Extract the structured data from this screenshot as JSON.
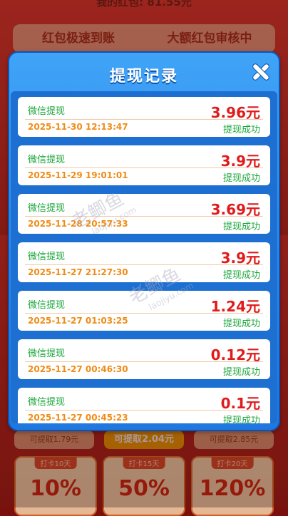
{
  "background": {
    "header": "我的红包: 81.55元",
    "tabs": [
      "红包极速到账",
      "大额红包审核中"
    ],
    "chips": [
      "可提取1.79元",
      "可提取2.04元",
      "可提取2.85元"
    ],
    "cards": [
      {
        "tag": "打卡10天",
        "pct": "10%"
      },
      {
        "tag": "打卡15天",
        "pct": "50%"
      },
      {
        "tag": "打卡20天",
        "pct": "120%"
      }
    ]
  },
  "modal": {
    "title": "提现记录",
    "records": [
      {
        "title": "微信提现",
        "amount": "3.96元",
        "time": "2025-11-30 12:13:47",
        "status": "提现成功"
      },
      {
        "title": "微信提现",
        "amount": "3.9元",
        "time": "2025-11-29 19:01:01",
        "status": "提现成功"
      },
      {
        "title": "微信提现",
        "amount": "3.69元",
        "time": "2025-11-28 20:57:33",
        "status": "提现成功"
      },
      {
        "title": "微信提现",
        "amount": "3.9元",
        "time": "2025-11-27 21:27:30",
        "status": "提现成功"
      },
      {
        "title": "微信提现",
        "amount": "1.24元",
        "time": "2025-11-27 01:03:25",
        "status": "提现成功"
      },
      {
        "title": "微信提现",
        "amount": "0.12元",
        "time": "2025-11-27 00:46:30",
        "status": "提现成功"
      },
      {
        "title": "微信提现",
        "amount": "0.1元",
        "time": "2025-11-27 00:45:23",
        "status": "提现成功"
      }
    ]
  },
  "watermark": {
    "text": "老鲫鱼",
    "domain": "laojiyu.com"
  },
  "colors": {
    "modal_blue": "#2a8cf0",
    "amount_red": "#e11b1b",
    "success_green": "#1aa53a",
    "time_orange": "#f08c16"
  }
}
